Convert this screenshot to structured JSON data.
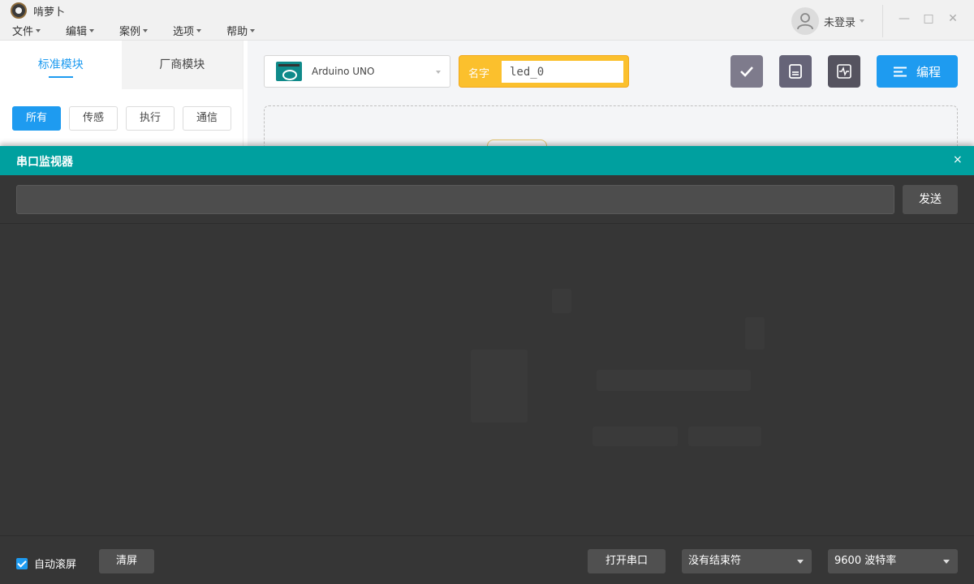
{
  "app": {
    "title": "啃萝卜"
  },
  "menu": [
    {
      "label": "文件"
    },
    {
      "label": "编辑"
    },
    {
      "label": "案例"
    },
    {
      "label": "选项"
    },
    {
      "label": "帮助"
    }
  ],
  "user": {
    "login_text": "未登录"
  },
  "window_controls": {
    "minimize": "—",
    "maximize": "□",
    "close": "✕"
  },
  "left_panel": {
    "tabs": [
      {
        "label": "标准模块",
        "active": true
      },
      {
        "label": "厂商模块",
        "active": false
      }
    ],
    "filters": [
      {
        "label": "所有",
        "active": true
      },
      {
        "label": "传感",
        "active": false
      },
      {
        "label": "执行",
        "active": false
      },
      {
        "label": "通信",
        "active": false
      }
    ]
  },
  "toolbar": {
    "board": "Arduino UNO",
    "name_label": "名字",
    "name_value": "led_0",
    "program_label": "编程",
    "icons": {
      "verify": "check-icon",
      "save": "save-icon",
      "monitor": "serial-monitor-icon"
    }
  },
  "serial_monitor": {
    "title": "串口监视器",
    "close": "×",
    "input_value": "",
    "send_label": "发送",
    "autoscroll_label": "自动滚屏",
    "autoscroll_checked": true,
    "clear_label": "清屏",
    "open_port_label": "打开串口",
    "line_ending": "没有结束符",
    "baud_rate": "9600 波特率"
  },
  "colors": {
    "accent": "#1e9bf0",
    "serial_header": "#00a09f",
    "name_box": "#fbc02d",
    "serial_bg": "#363636"
  }
}
